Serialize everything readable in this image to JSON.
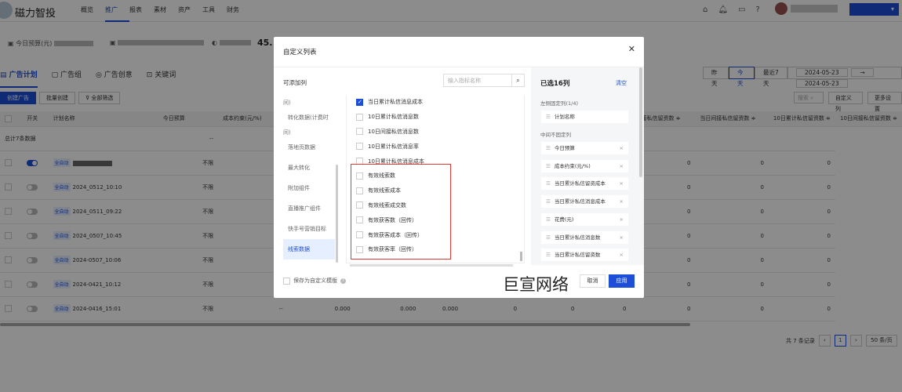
{
  "app": {
    "name": "磁力智投"
  },
  "nav": [
    "概览",
    "推广",
    "报表",
    "素材",
    "资产",
    "工具",
    "财务"
  ],
  "nav_active": 1,
  "stats": {
    "budget_label": "今日预算(元)",
    "third_value": "45."
  },
  "tabs": [
    "广告计划",
    "广告组",
    "广告创意",
    "关键词"
  ],
  "actions": {
    "create": "创建广告",
    "batch": "批量创建",
    "filter": "全部筛选"
  },
  "dates": {
    "yesterday": "昨天",
    "today": "今天",
    "last7": "最近7天",
    "start": "2024-05-23",
    "arrow": "→",
    "end": "2024-05-23"
  },
  "right_actions": {
    "search_placeholder": "搜索",
    "custom": "自定义列",
    "more": "更多设置"
  },
  "table": {
    "headers": [
      "开关",
      "计划名称",
      "今日预算",
      "成本约束(元/%)",
      "",
      "",
      "",
      "",
      "",
      "",
      "直接私信留资数 ≑",
      "当日间接私信留资数 ≑",
      "10日累计私信留资数 ≑",
      "10日间接私信留资数 ≑"
    ],
    "total_label": "总计7条数据",
    "total_budget": "--",
    "tag": "全自动",
    "rows": [
      {
        "on": true,
        "name": "",
        "budget": "不限",
        "cells": [
          "",
          "",
          "",
          "",
          "",
          "",
          "",
          "0",
          "0",
          "0"
        ]
      },
      {
        "on": false,
        "name": "2024_0512_10:10",
        "budget": "不限",
        "cells": [
          "",
          "",
          "",
          "",
          "",
          "",
          "",
          "0",
          "0",
          "0"
        ]
      },
      {
        "on": false,
        "name": "2024_0511_09:22",
        "budget": "不限",
        "cells": [
          "",
          "",
          "",
          "",
          "",
          "",
          "",
          "0",
          "0",
          "0"
        ]
      },
      {
        "on": false,
        "name": "2024_0507_10:45",
        "budget": "不限",
        "cells": [
          "",
          "",
          "",
          "",
          "",
          "",
          "",
          "0",
          "0",
          "0"
        ]
      },
      {
        "on": false,
        "name": "2024-0507_10:06",
        "budget": "不限",
        "cells": [
          "",
          "",
          "",
          "",
          "",
          "",
          "",
          "0",
          "0",
          "0"
        ]
      },
      {
        "on": false,
        "name": "2024-0421_10:12",
        "budget": "不限",
        "cells": [
          "",
          "",
          "",
          "",
          "",
          "",
          "",
          "0",
          "0",
          "0"
        ]
      },
      {
        "on": false,
        "name": "2024-0416_15:01",
        "budget": "不限",
        "cells": [
          "--",
          "0.000",
          "0.000",
          "0.000",
          "0",
          "0",
          "0",
          "0",
          "0",
          "0"
        ]
      }
    ]
  },
  "pager": {
    "total": "共 7 条记录",
    "current": "1",
    "size": "50 条/页"
  },
  "modal": {
    "title": "自定义列表",
    "left_title": "可添加列",
    "search_placeholder": "输入指标名称",
    "categories": [
      {
        "label": "间)",
        "frag": true
      },
      {
        "label": "转化数据(计费时"
      },
      {
        "label": "间)",
        "frag": true
      },
      {
        "label": "落地页数据"
      },
      {
        "label": "最大转化"
      },
      {
        "label": "附加组件"
      },
      {
        "label": "直播推广组件"
      },
      {
        "label": "快手号营销目标"
      },
      {
        "label": "线索数据",
        "active": true
      }
    ],
    "options": [
      {
        "label": "当日累计私信消息成本",
        "checked": true
      },
      {
        "label": "10日累计私信消息数",
        "checked": false
      },
      {
        "label": "10日间接私信消息数",
        "checked": false
      },
      {
        "label": "10日累计私信消息率",
        "checked": false
      },
      {
        "label": "10日累计私信消息成本",
        "checked": false
      },
      {
        "label": "有效线索数",
        "checked": false
      },
      {
        "label": "有效线索成本",
        "checked": false
      },
      {
        "label": "有效线索成交数",
        "checked": false
      },
      {
        "label": "有效获客数（回传）",
        "checked": false
      },
      {
        "label": "有效获客成本（回传）",
        "checked": false
      },
      {
        "label": "有效获客率（回传）",
        "checked": false
      }
    ],
    "selected_title": "已选16列",
    "clear": "清空",
    "fixed_label": "左侧固定列(1/4)",
    "fixed_items": [
      "计划名称"
    ],
    "middle_label": "中间不固定列",
    "middle_items": [
      "今日预算",
      "成本约束(元/%)",
      "当日累计私信留资成本",
      "当日累计私信消息成本",
      "花费(元)",
      "当日累计私信消息数",
      "当日累计私信留资数"
    ],
    "save_template": "保存为自定义模版",
    "watermark": "巨宣网络",
    "cancel": "取消",
    "apply": "应用"
  },
  "colors": {
    "accent": "#1d4ed8",
    "highlight_box": "#e53935"
  }
}
